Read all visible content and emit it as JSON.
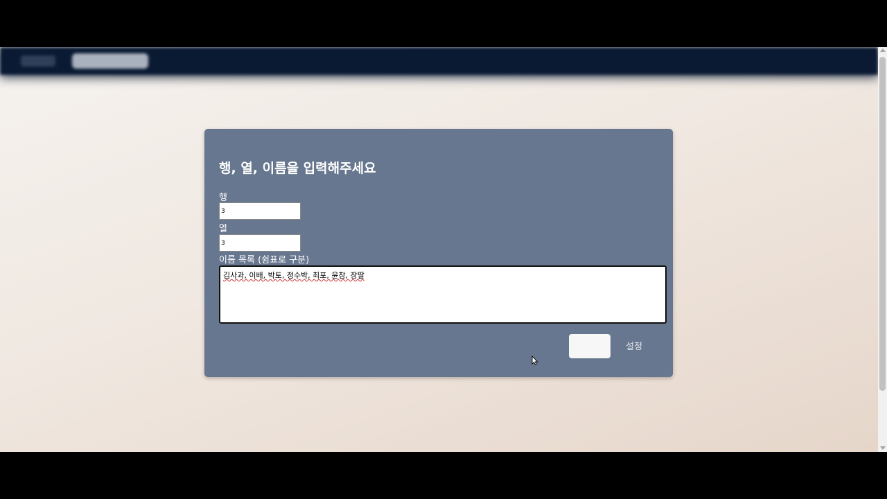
{
  "dialog": {
    "title": "행, 열, 이름을 입력해주세요",
    "rows": {
      "label": "행",
      "value": "3"
    },
    "cols": {
      "label": "열",
      "value": "3"
    },
    "names": {
      "label": "이름 목록 (쉼표로 구분)",
      "value": "김사과, 이배, 박토, 정수박, 최포, 윤참, 장딸"
    },
    "confirm_label": "",
    "settings_label": "설정"
  },
  "colors": {
    "navbar": "#0a1a33",
    "dialog_bg": "#67778f",
    "page_bg": "#f0e8e1"
  },
  "icons": {
    "cursor": "mouse-pointer-icon"
  }
}
